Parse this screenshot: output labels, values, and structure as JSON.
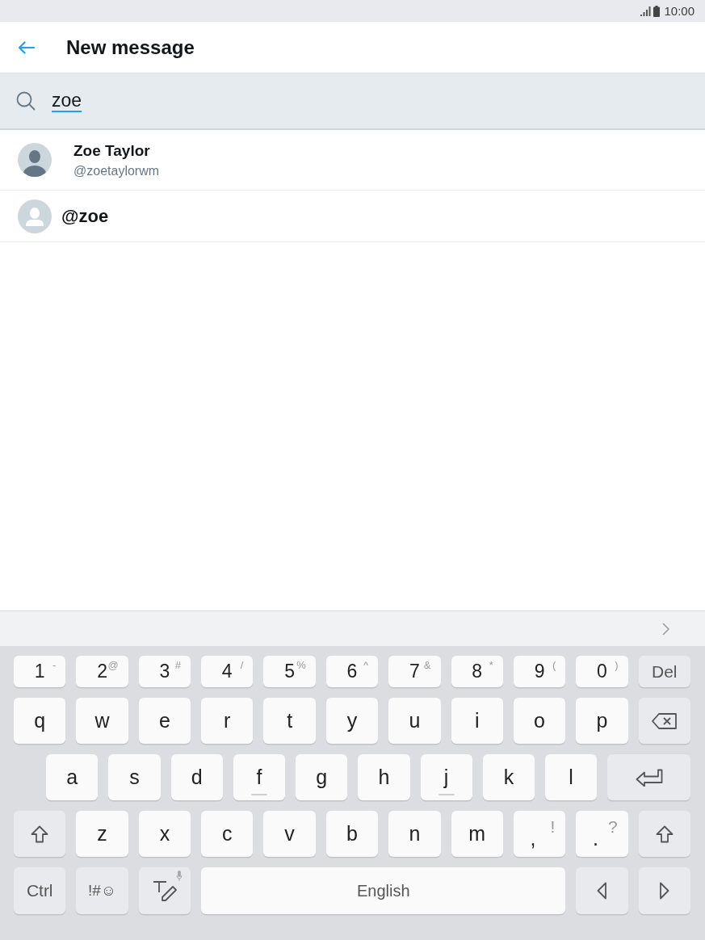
{
  "status_bar": {
    "time": "10:00"
  },
  "header": {
    "title": "New message"
  },
  "search": {
    "value": "zoe",
    "composing": true
  },
  "results": [
    {
      "kind": "user",
      "name": "Zoe Taylor",
      "handle": "@zoetaylorwm"
    },
    {
      "kind": "handle",
      "handle": "@zoe"
    }
  ],
  "keyboard": {
    "rows": [
      [
        {
          "kind": "char",
          "label": "1",
          "hint": "-"
        },
        {
          "kind": "char",
          "label": "2",
          "hint": "@"
        },
        {
          "kind": "char",
          "label": "3",
          "hint": "#"
        },
        {
          "kind": "char",
          "label": "4",
          "hint": "/"
        },
        {
          "kind": "char",
          "label": "5",
          "hint": "%"
        },
        {
          "kind": "char",
          "label": "6",
          "hint": "^"
        },
        {
          "kind": "char",
          "label": "7",
          "hint": "&"
        },
        {
          "kind": "char",
          "label": "8",
          "hint": "*"
        },
        {
          "kind": "char",
          "label": "9",
          "hint": "("
        },
        {
          "kind": "char",
          "label": "0",
          "hint": ")"
        },
        {
          "kind": "del",
          "label": "Del"
        }
      ],
      [
        {
          "kind": "char",
          "label": "q"
        },
        {
          "kind": "char",
          "label": "w"
        },
        {
          "kind": "char",
          "label": "e"
        },
        {
          "kind": "char",
          "label": "r"
        },
        {
          "kind": "char",
          "label": "t"
        },
        {
          "kind": "char",
          "label": "y"
        },
        {
          "kind": "char",
          "label": "u"
        },
        {
          "kind": "char",
          "label": "i"
        },
        {
          "kind": "char",
          "label": "o"
        },
        {
          "kind": "char",
          "label": "p"
        },
        {
          "kind": "backspace"
        }
      ],
      [
        {
          "kind": "char",
          "label": "a",
          "home_mark": false
        },
        {
          "kind": "char",
          "label": "s",
          "home_mark": false
        },
        {
          "kind": "char",
          "label": "d",
          "home_mark": false
        },
        {
          "kind": "char",
          "label": "f",
          "home_mark": true
        },
        {
          "kind": "char",
          "label": "g",
          "home_mark": false
        },
        {
          "kind": "char",
          "label": "h",
          "home_mark": false
        },
        {
          "kind": "char",
          "label": "j",
          "home_mark": true
        },
        {
          "kind": "char",
          "label": "k",
          "home_mark": false
        },
        {
          "kind": "char",
          "label": "l",
          "home_mark": false
        },
        {
          "kind": "enter",
          "home_mark": false
        }
      ],
      [
        {
          "kind": "shift"
        },
        {
          "kind": "char",
          "label": "z"
        },
        {
          "kind": "char",
          "label": "x"
        },
        {
          "kind": "char",
          "label": "c"
        },
        {
          "kind": "char",
          "label": "v"
        },
        {
          "kind": "char",
          "label": "b"
        },
        {
          "kind": "char",
          "label": "n"
        },
        {
          "kind": "char",
          "label": "m"
        },
        {
          "kind": "char",
          "label": ",",
          "hint": "!"
        },
        {
          "kind": "char",
          "label": ".",
          "hint": "?"
        },
        {
          "kind": "shift"
        }
      ],
      [
        {
          "kind": "ctrl",
          "label": "Ctrl"
        },
        {
          "kind": "symbols",
          "label": "!#☺"
        },
        {
          "kind": "handwriting"
        },
        {
          "kind": "space",
          "label": "English"
        },
        {
          "kind": "left"
        },
        {
          "kind": "right"
        }
      ]
    ]
  }
}
